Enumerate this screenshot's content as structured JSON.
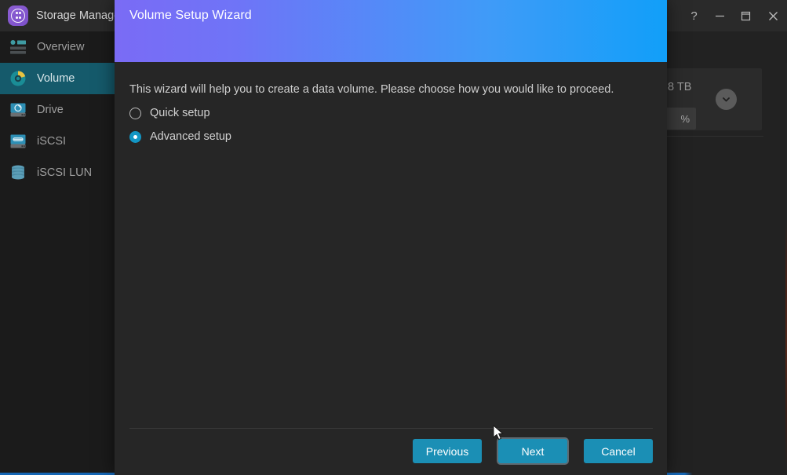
{
  "window": {
    "app_title": "Storage Manager",
    "logo_icon": "storage-manager-logo-icon",
    "controls": [
      {
        "name": "help-button",
        "icon": "question-mark-icon",
        "label": "?"
      },
      {
        "name": "minimize-button",
        "icon": "minimize-icon",
        "label": "—"
      },
      {
        "name": "maximize-button",
        "icon": "maximize-icon",
        "label": "□"
      },
      {
        "name": "close-button",
        "icon": "close-icon",
        "label": "✕"
      }
    ]
  },
  "sidebar": {
    "items": [
      {
        "label": "Overview",
        "icon": "overview-icon",
        "active": false
      },
      {
        "label": "Volume",
        "icon": "volume-icon",
        "active": true
      },
      {
        "label": "Drive",
        "icon": "drive-icon",
        "active": false
      },
      {
        "label": "iSCSI",
        "icon": "iscsi-icon",
        "active": false
      },
      {
        "label": "iSCSI LUN",
        "icon": "iscsi-lun-icon",
        "active": false
      }
    ]
  },
  "background_content": {
    "storage_card": {
      "capacity": "8 TB",
      "usage_badge": "%",
      "expand_icon": "chevron-down-icon"
    }
  },
  "dialog": {
    "title": "Volume Setup Wizard",
    "description": "This wizard will help you to create a data volume. Please choose how you would like to proceed.",
    "options": [
      {
        "label": "Quick setup",
        "selected": false
      },
      {
        "label": "Advanced setup",
        "selected": true
      }
    ],
    "buttons": [
      {
        "label": "Previous",
        "name": "previous-button",
        "focused": false
      },
      {
        "label": "Next",
        "name": "next-button",
        "focused": true
      },
      {
        "label": "Cancel",
        "name": "cancel-button",
        "focused": false
      }
    ]
  },
  "colors": {
    "accent_button": "#1b8fb5",
    "accent_radio": "#1396c4",
    "sidebar_active": "#155a6b",
    "header_gradient_start": "#7a6bf5",
    "header_gradient_end": "#119ff9",
    "logo_purple": "#8d5fd3"
  }
}
